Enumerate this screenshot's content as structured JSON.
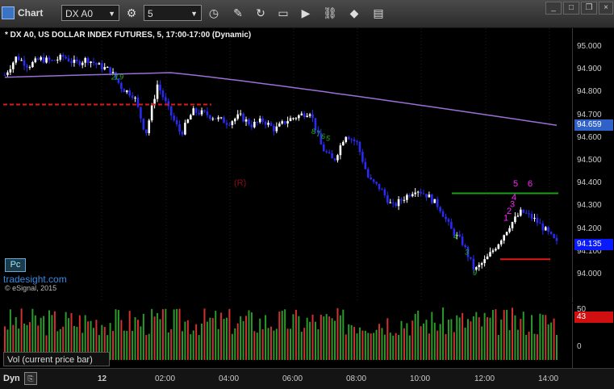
{
  "toolbar": {
    "tab_label": "Chart",
    "symbol": "DX A0",
    "interval": "5"
  },
  "chart": {
    "title": "* DX A0, US DOLLAR INDEX FUTURES, 5, 17:00-17:00 (Dynamic)",
    "pc_button": "Pc",
    "watermark": "tradesight.com",
    "copyright": "© eSignal, 2015",
    "marker_r": "(R)",
    "last_price": "94.135",
    "ma_price": "94.659",
    "colors": {
      "ma_tag": "#2f62c8",
      "last_tag": "#0a1aff",
      "vol_tag": "#d01010",
      "up": "#ffffff",
      "down": "#2a2af0",
      "ma_line": "#9a70d8"
    }
  },
  "chart_data": {
    "type": "candlestick",
    "price_axis_ticks": [
      "95.000",
      "94.900",
      "94.800",
      "94.700",
      "94.600",
      "94.500",
      "94.400",
      "94.300",
      "94.200",
      "94.100",
      "94.000"
    ],
    "ylim": [
      93.95,
      95.1
    ],
    "x_tick_labels": [
      "12",
      "02:00",
      "04:00",
      "06:00",
      "08:00",
      "10:00",
      "12:00",
      "14:00"
    ],
    "close_path": [
      94.88,
      94.96,
      94.92,
      94.95,
      94.94,
      94.96,
      94.93,
      94.95,
      94.92,
      94.9,
      94.82,
      94.79,
      94.62,
      94.84,
      94.72,
      94.62,
      94.72,
      94.71,
      94.69,
      94.67,
      94.7,
      94.66,
      94.68,
      94.64,
      94.68,
      94.7,
      94.72,
      94.56,
      94.5,
      94.62,
      94.58,
      94.42,
      94.38,
      94.3,
      94.34,
      94.38,
      94.35,
      94.3,
      94.2,
      94.14,
      94.02,
      94.07,
      94.14,
      94.22,
      94.28,
      94.25,
      94.2,
      94.14
    ],
    "moving_average_endpoints": {
      "start": 94.87,
      "mid": 94.89,
      "end": 94.659
    },
    "red_levels": [
      94.75,
      94.07
    ],
    "green_levels": [
      94.36
    ],
    "setup_labels_magenta": [
      "1",
      "2",
      "3",
      "4",
      "5",
      "6"
    ],
    "setup_labels_green": [
      "2",
      "1",
      "9",
      "8",
      "7",
      "6",
      "5",
      "4",
      "3",
      "9"
    ],
    "last_price": 94.135,
    "ma_price": 94.659
  },
  "volume": {
    "label": "Vol (current price bar)",
    "axis_ticks": [
      "50",
      "0"
    ],
    "current_value": "43"
  },
  "xaxis": {
    "dyn_label": "Dyn"
  }
}
